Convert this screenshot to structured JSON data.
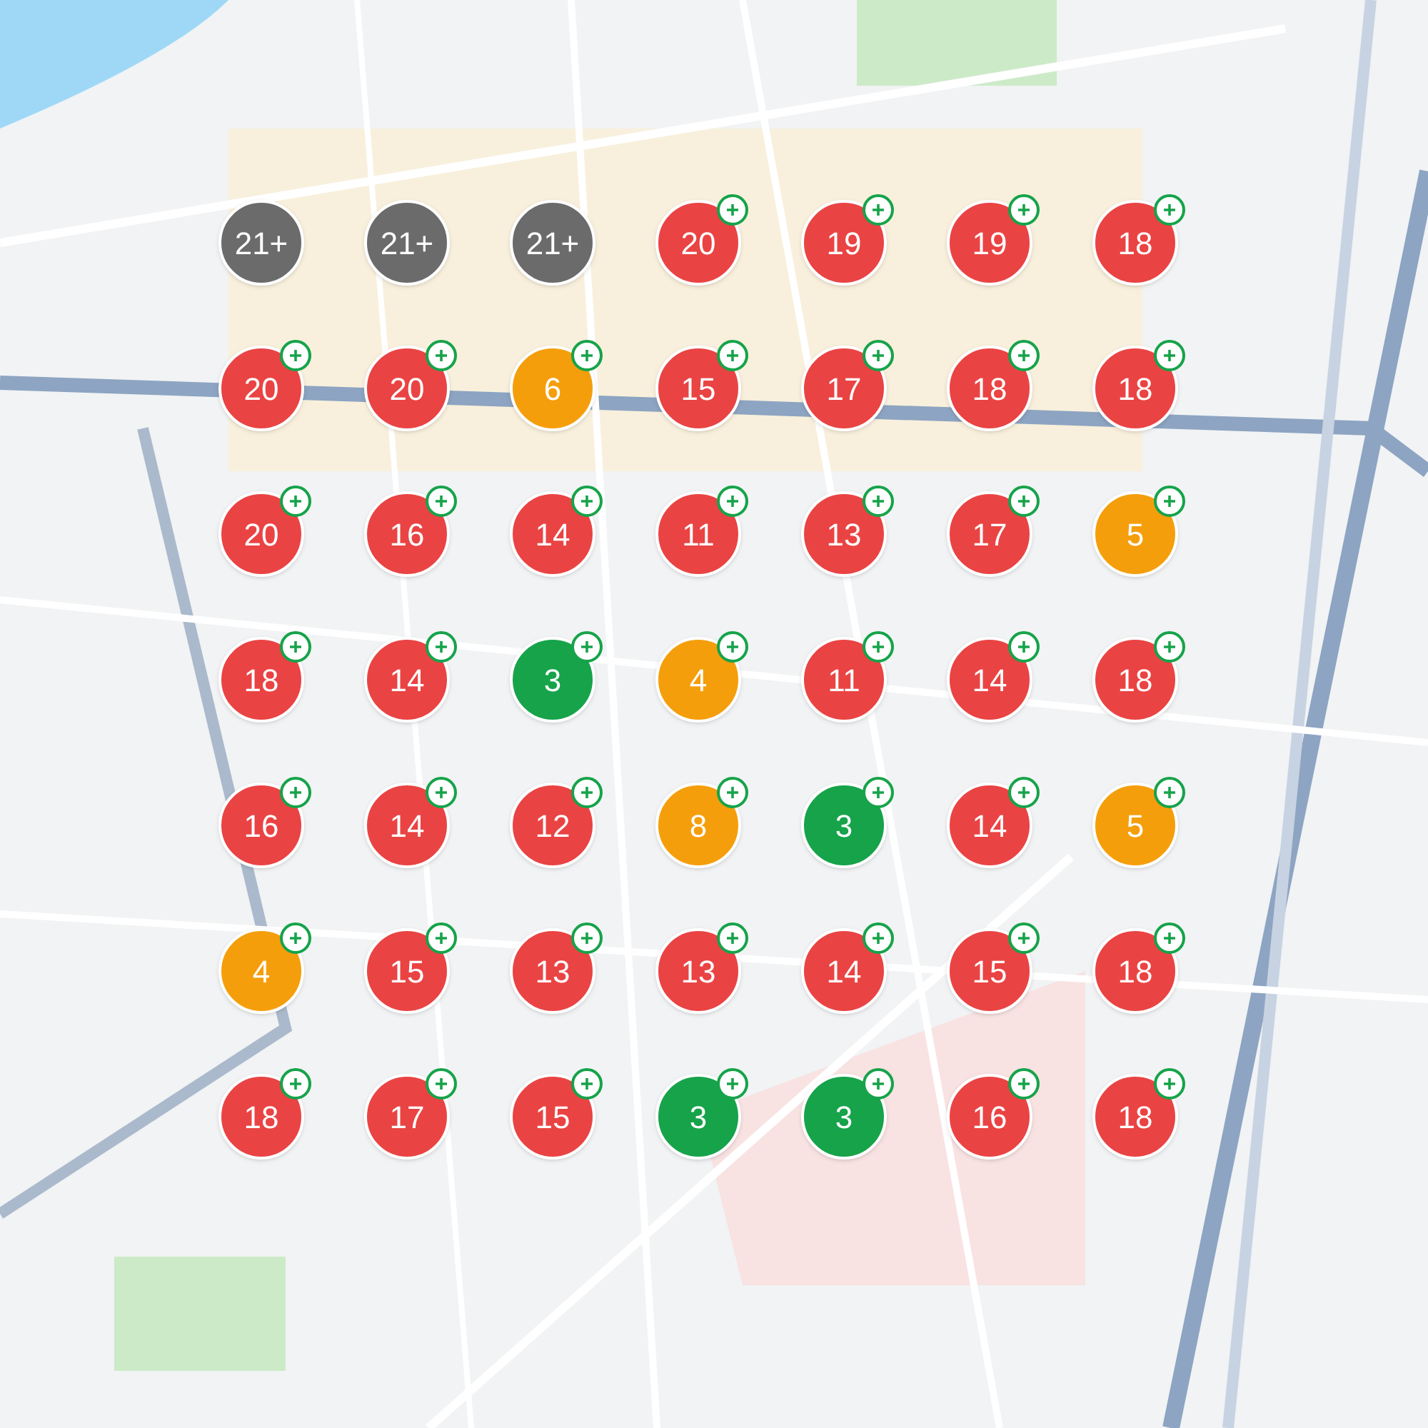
{
  "rows": [
    {
      "markers": [
        {
          "count": "21+",
          "color": "#6b6b6b",
          "badge": false
        },
        {
          "count": "21+",
          "color": "#6b6b6b",
          "badge": false
        },
        {
          "count": "21+",
          "color": "#6b6b6b",
          "badge": false
        },
        {
          "count": "20",
          "color": "#ea4343",
          "badge": true
        },
        {
          "count": "19",
          "color": "#ea4343",
          "badge": true
        },
        {
          "count": "19",
          "color": "#ea4343",
          "badge": true
        },
        {
          "count": "18",
          "color": "#ea4343",
          "badge": true
        }
      ]
    },
    {
      "markers": [
        {
          "count": "20",
          "color": "#ea4343",
          "badge": true
        },
        {
          "count": "20",
          "color": "#ea4343",
          "badge": true
        },
        {
          "count": "6",
          "color": "#f59e0b",
          "badge": true
        },
        {
          "count": "15",
          "color": "#ea4343",
          "badge": true
        },
        {
          "count": "17",
          "color": "#ea4343",
          "badge": true
        },
        {
          "count": "18",
          "color": "#ea4343",
          "badge": true
        },
        {
          "count": "18",
          "color": "#ea4343",
          "badge": true
        }
      ]
    },
    {
      "markers": [
        {
          "count": "20",
          "color": "#ea4343",
          "badge": true
        },
        {
          "count": "16",
          "color": "#ea4343",
          "badge": true
        },
        {
          "count": "14",
          "color": "#ea4343",
          "badge": true
        },
        {
          "count": "11",
          "color": "#ea4343",
          "badge": true
        },
        {
          "count": "13",
          "color": "#ea4343",
          "badge": true
        },
        {
          "count": "17",
          "color": "#ea4343",
          "badge": true
        },
        {
          "count": "5",
          "color": "#f59e0b",
          "badge": true
        }
      ]
    },
    {
      "markers": [
        {
          "count": "18",
          "color": "#ea4343",
          "badge": true
        },
        {
          "count": "14",
          "color": "#ea4343",
          "badge": true
        },
        {
          "count": "3",
          "color": "#16a34a",
          "badge": true
        },
        {
          "count": "4",
          "color": "#f59e0b",
          "badge": true
        },
        {
          "count": "11",
          "color": "#ea4343",
          "badge": true
        },
        {
          "count": "14",
          "color": "#ea4343",
          "badge": true
        },
        {
          "count": "18",
          "color": "#ea4343",
          "badge": true
        }
      ]
    },
    {
      "markers": [
        {
          "count": "16",
          "color": "#ea4343",
          "badge": true
        },
        {
          "count": "14",
          "color": "#ea4343",
          "badge": true
        },
        {
          "count": "12",
          "color": "#ea4343",
          "badge": true
        },
        {
          "count": "8",
          "color": "#f59e0b",
          "badge": true
        },
        {
          "count": "3",
          "color": "#16a34a",
          "badge": true
        },
        {
          "count": "14",
          "color": "#ea4343",
          "badge": true
        },
        {
          "count": "5",
          "color": "#f59e0b",
          "badge": true
        }
      ]
    },
    {
      "markers": [
        {
          "count": "4",
          "color": "#f59e0b",
          "badge": true
        },
        {
          "count": "15",
          "color": "#ea4343",
          "badge": true
        },
        {
          "count": "13",
          "color": "#ea4343",
          "badge": true
        },
        {
          "count": "13",
          "color": "#ea4343",
          "badge": true
        },
        {
          "count": "14",
          "color": "#ea4343",
          "badge": true
        },
        {
          "count": "15",
          "color": "#ea4343",
          "badge": true
        },
        {
          "count": "18",
          "color": "#ea4343",
          "badge": true
        }
      ]
    },
    {
      "markers": [
        {
          "count": "18",
          "color": "#ea4343",
          "badge": true
        },
        {
          "count": "17",
          "color": "#ea4343",
          "badge": true
        },
        {
          "count": "15",
          "color": "#ea4343",
          "badge": true
        },
        {
          "count": "3",
          "color": "#16a34a",
          "badge": true
        },
        {
          "count": "3",
          "color": "#16a34a",
          "badge": true
        },
        {
          "count": "16",
          "color": "#ea4343",
          "badge": true
        },
        {
          "count": "18",
          "color": "#ea4343",
          "badge": true
        }
      ]
    }
  ]
}
